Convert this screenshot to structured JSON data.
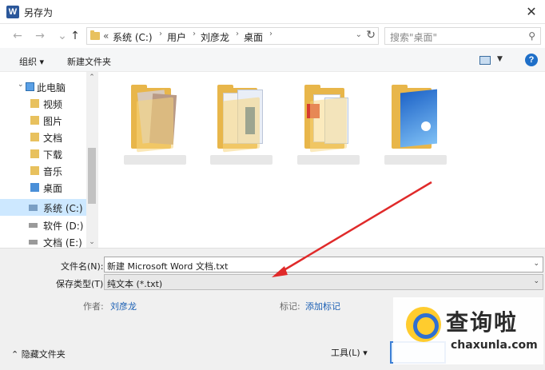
{
  "window": {
    "title": "另存为",
    "app_icon": "W",
    "close_glyph": "✕"
  },
  "nav": {
    "back_glyph": "←",
    "forward_glyph": "→",
    "up_glyph": "↑",
    "address_prefix": "«",
    "breadcrumbs": [
      "系统 (C:)",
      "用户",
      "刘彦龙",
      "桌面"
    ],
    "search_placeholder": "搜索\"桌面\""
  },
  "toolbar": {
    "organize_label": "组织 ▾",
    "new_folder_label": "新建文件夹"
  },
  "sidebar": {
    "items": [
      {
        "label": "此电脑",
        "icon": "computer-icon"
      },
      {
        "label": "视频",
        "icon": "video-folder-icon"
      },
      {
        "label": "图片",
        "icon": "pictures-folder-icon"
      },
      {
        "label": "文档",
        "icon": "documents-folder-icon"
      },
      {
        "label": "下载",
        "icon": "download-folder-icon"
      },
      {
        "label": "音乐",
        "icon": "music-folder-icon"
      },
      {
        "label": "桌面",
        "icon": "desktop-folder-icon"
      },
      {
        "label": "系统 (C:)",
        "icon": "system-drive-icon",
        "selected": true
      },
      {
        "label": "软件 (D:)",
        "icon": "drive-icon"
      },
      {
        "label": "文档 (E:)",
        "icon": "drive-icon"
      }
    ]
  },
  "files": [
    {
      "label": "",
      "icon": "folder-with-certificate-icon"
    },
    {
      "label": "",
      "icon": "folder-with-photos-icon"
    },
    {
      "label": "",
      "icon": "folder-with-pdf-icon"
    },
    {
      "label": "",
      "icon": "folder-with-wallpaper-icon"
    }
  ],
  "form": {
    "filename_label": "文件名(N):",
    "filename_value": "新建 Microsoft Word 文档.txt",
    "filetype_label": "保存类型(T):",
    "filetype_value": "纯文本 (*.txt)",
    "author_label": "作者:",
    "author_value": "刘彦龙",
    "tags_label": "标记:",
    "tags_value": "添加标记"
  },
  "footer": {
    "hide_folders_label": "隐藏文件夹",
    "tools_label": "工具(L)"
  },
  "watermark": {
    "title": "查询啦",
    "subtitle": "chaxunla.com"
  },
  "colors": {
    "accent": "#1a5fb4",
    "selection": "#cde8ff",
    "annotation_arrow": "#e02a2a",
    "folder": "#e8b64a"
  }
}
